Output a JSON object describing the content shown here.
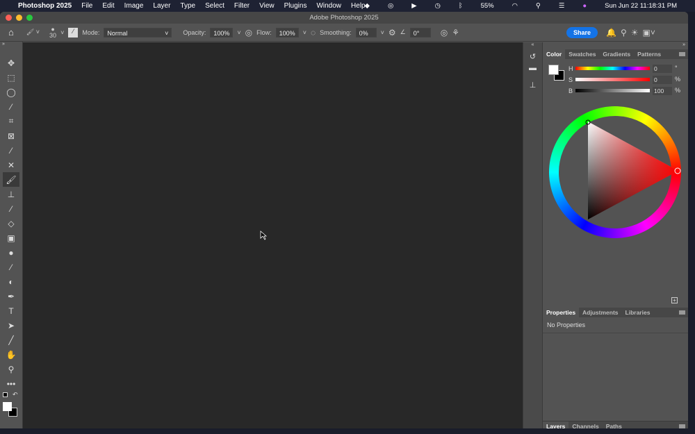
{
  "menubar": {
    "app": "Photoshop 2025",
    "items": [
      "File",
      "Edit",
      "Image",
      "Layer",
      "Type",
      "Select",
      "Filter",
      "View",
      "Plugins",
      "Window",
      "Help"
    ],
    "battery": "55%",
    "datetime": "Sun Jun 22  11:18:31 PM"
  },
  "window": {
    "title": "Adobe Photoshop 2025"
  },
  "options": {
    "brush_size": "30",
    "mode_label": "Mode:",
    "mode": "Normal",
    "opacity_label": "Opacity:",
    "opacity": "100%",
    "flow_label": "Flow:",
    "flow": "100%",
    "smoothing_label": "Smoothing:",
    "smoothing": "0%",
    "angle": "0°",
    "share": "Share"
  },
  "tools": [
    {
      "name": "move",
      "g": "✥"
    },
    {
      "name": "marquee",
      "g": "⬚"
    },
    {
      "name": "lasso",
      "g": "◯"
    },
    {
      "name": "magic-wand",
      "g": "⁄"
    },
    {
      "name": "crop",
      "g": "⌗"
    },
    {
      "name": "frame",
      "g": "⊠"
    },
    {
      "name": "eyedropper",
      "g": "⁄"
    },
    {
      "name": "healing",
      "g": "✕"
    },
    {
      "name": "brush",
      "g": "🖌"
    },
    {
      "name": "stamp",
      "g": "⊥"
    },
    {
      "name": "history-brush",
      "g": "⁄"
    },
    {
      "name": "eraser",
      "g": "◇"
    },
    {
      "name": "gradient",
      "g": "▣"
    },
    {
      "name": "blur",
      "g": "●"
    },
    {
      "name": "dodge",
      "g": "⁄"
    },
    {
      "name": "sponge",
      "g": "◐"
    },
    {
      "name": "pen",
      "g": "✒"
    },
    {
      "name": "type",
      "g": "T"
    },
    {
      "name": "path-select",
      "g": "➤"
    },
    {
      "name": "line",
      "g": "╱"
    },
    {
      "name": "hand",
      "g": "✋"
    },
    {
      "name": "zoom",
      "g": "⚲"
    },
    {
      "name": "more",
      "g": "•••"
    }
  ],
  "color_panel": {
    "tabs": [
      "Color",
      "Swatches",
      "Gradients",
      "Patterns"
    ],
    "h_label": "H",
    "s_label": "S",
    "b_label": "B",
    "h": "0",
    "s": "0",
    "b": "100",
    "h_unit": "°",
    "s_unit": "%",
    "b_unit": "%",
    "foreground": "#ffffff",
    "background": "#000000"
  },
  "properties_panel": {
    "tabs": [
      "Properties",
      "Adjustments",
      "Libraries"
    ],
    "text": "No Properties"
  },
  "layers_panel": {
    "tabs": [
      "Layers",
      "Channels",
      "Paths"
    ]
  },
  "colors": {
    "accent": "#1473e6"
  }
}
